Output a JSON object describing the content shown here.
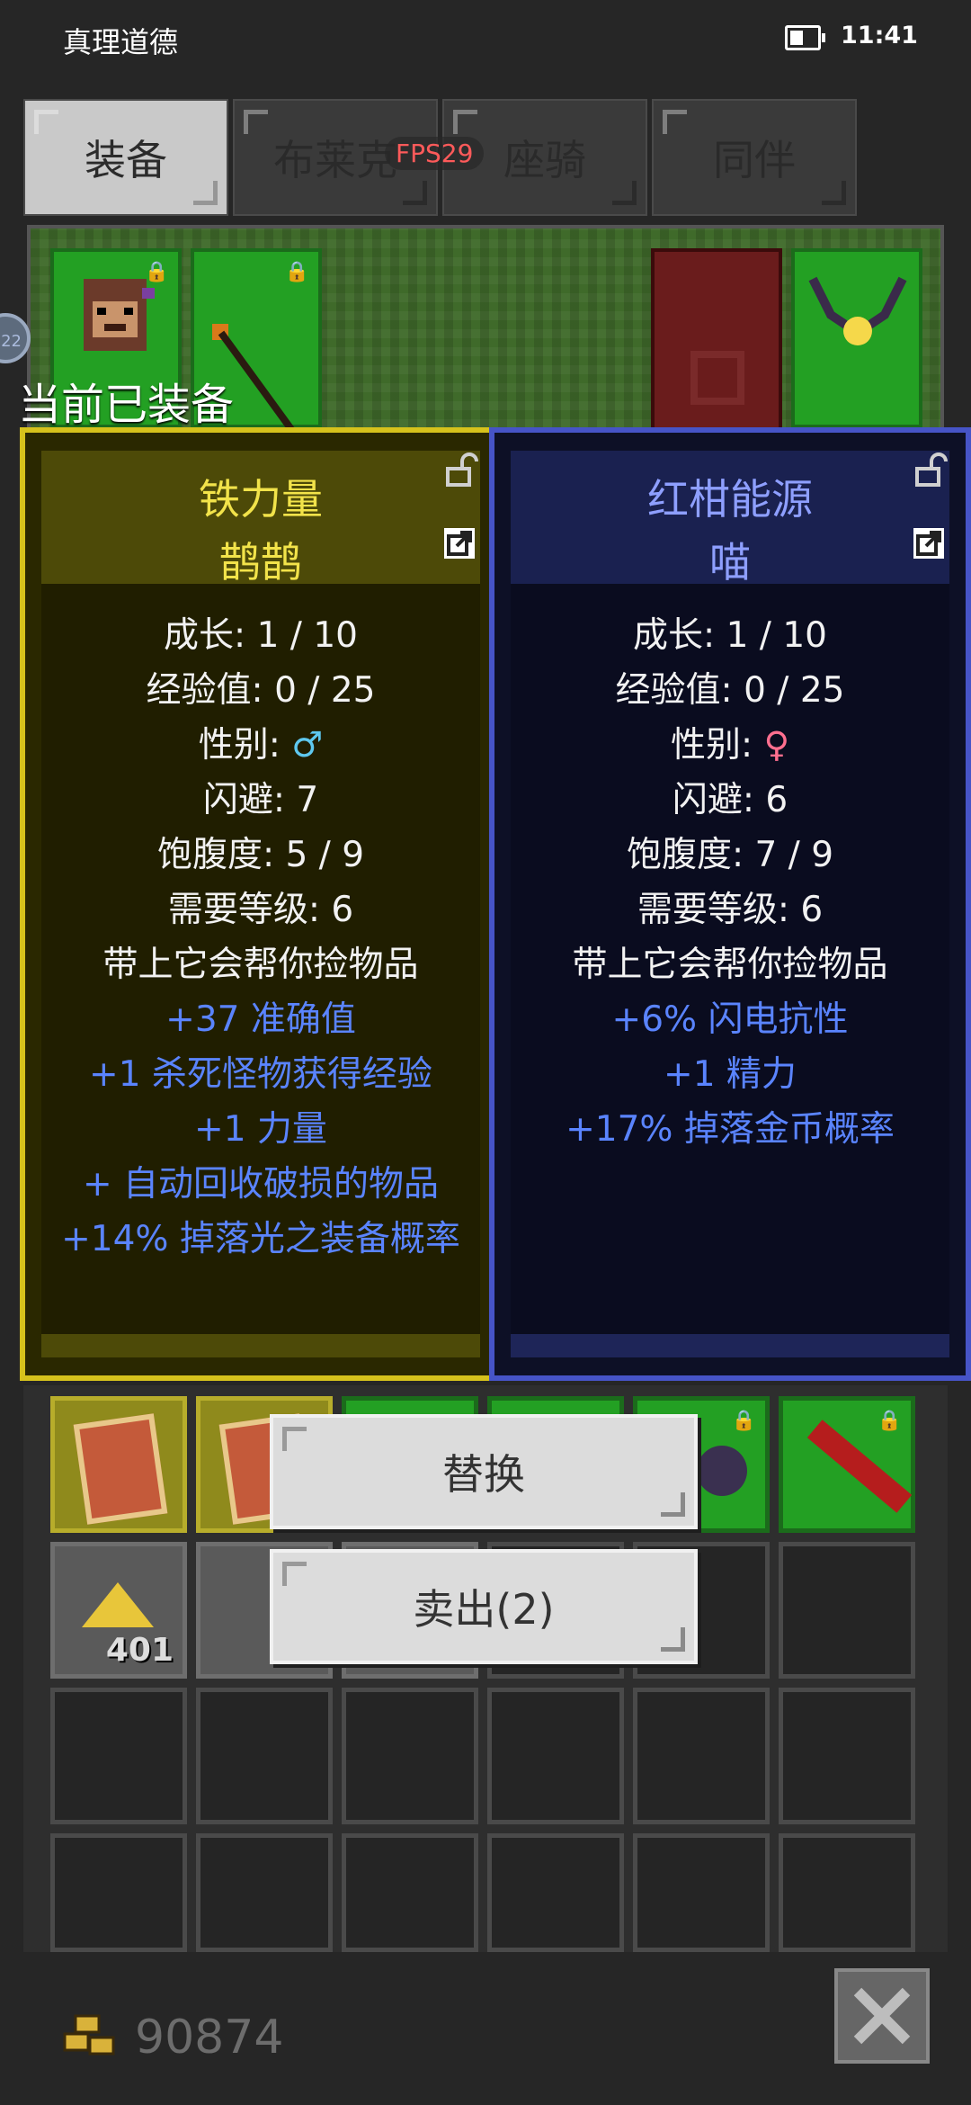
{
  "status_bar": {
    "title": "真理道德",
    "time": "11:41"
  },
  "tabs": [
    {
      "label": "装备",
      "active": true
    },
    {
      "label": "布莱克",
      "active": false
    },
    {
      "label": "座骑",
      "active": false
    },
    {
      "label": "同伴",
      "active": false
    }
  ],
  "fps": "FPS29",
  "side_bubble": "22",
  "equipped_label": "当前已装备",
  "cards": [
    {
      "title": "铁力量",
      "subtitle": "鹊鹊",
      "stats": [
        "成长: 1 / 10",
        "经验值: 0 / 25"
      ],
      "gender_label": "性别: ",
      "gender_symbol": "♂",
      "stats2": [
        "闪避: 7",
        "饱腹度: 5 / 9",
        "需要等级: 6",
        "带上它会帮你捡物品"
      ],
      "bonuses": [
        "+37 准确值",
        "+1 杀死怪物获得经验",
        "+1 力量",
        "+ 自动回收破损的物品",
        "+14% 掉落光之装备概率"
      ]
    },
    {
      "title": "红柑能源",
      "subtitle": "喵",
      "stats": [
        "成长: 1 / 10",
        "经验值: 0 / 25"
      ],
      "gender_label": "性别: ",
      "gender_symbol": "♀",
      "stats2": [
        "闪避: 6",
        "饱腹度: 7 / 9",
        "需要等级: 6",
        "带上它会帮你捡物品"
      ],
      "bonuses": [
        "+6% 闪电抗性",
        "+1 精力",
        "+17% 掉落金币概率"
      ]
    }
  ],
  "buttons": {
    "replace": "替换",
    "sell": "卖出(2)"
  },
  "inventory": {
    "gold_pile_count": "401"
  },
  "gold_total": "90874",
  "colors": {
    "yellow_border": "#d6c21c",
    "blue_border": "#4654c7",
    "bonus_text": "#5a84ff"
  }
}
